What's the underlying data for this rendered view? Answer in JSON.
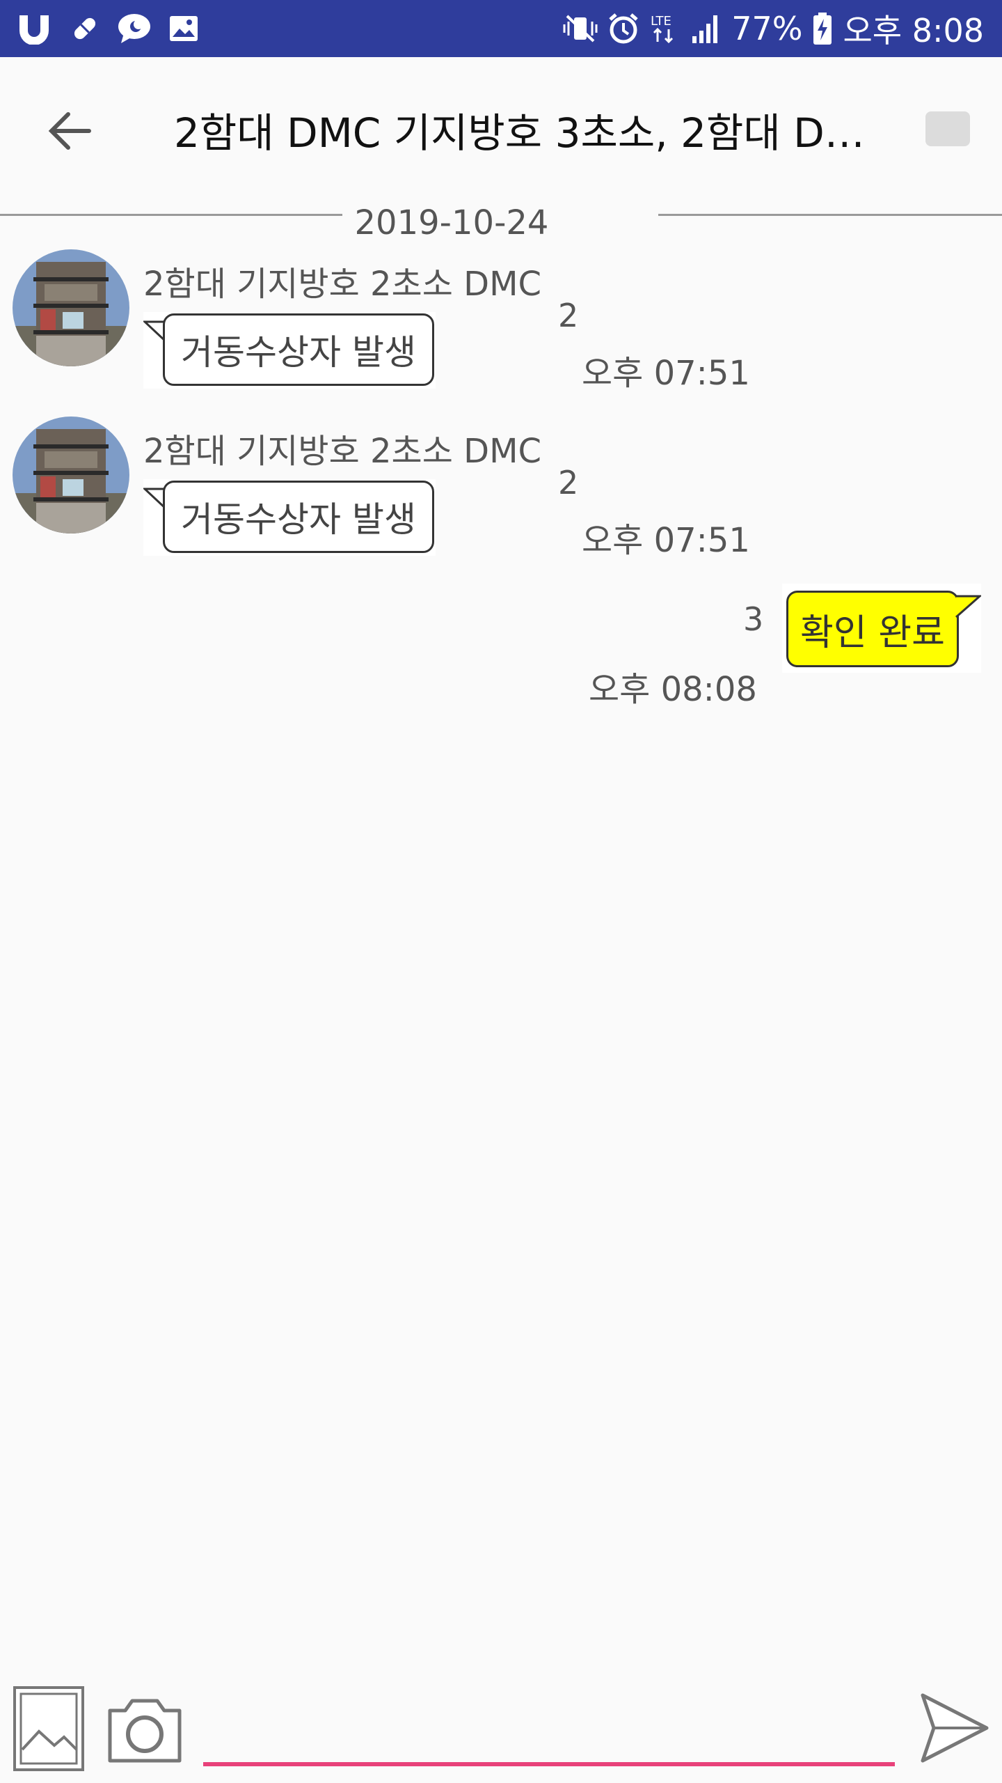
{
  "status_bar": {
    "left_icons": [
      "u-plus-icon",
      "pill-icon",
      "chat-bubble-icon",
      "image-icon"
    ],
    "right_icons": [
      "mute-vibrate-icon",
      "alarm-icon",
      "lte-icon",
      "signal-icon"
    ],
    "battery_percent": "77%",
    "battery_icon": "battery-charging-icon",
    "time": "오후 8:08"
  },
  "header": {
    "title": "2함대 DMC 기지방호 3초소, 2함대 DM…",
    "back_icon": "arrow-left-icon"
  },
  "chat": {
    "date_separator": "2019-10-24",
    "messages": [
      {
        "direction": "in",
        "sender": "2함대 기지방호 2초소 DMC",
        "text": "거동수상자 발생",
        "unread_count": "2",
        "time": "오후 07:51"
      },
      {
        "direction": "in",
        "sender": "2함대 기지방호 2초소 DMC",
        "text": "거동수상자 발생",
        "unread_count": "2",
        "time": "오후 07:51"
      },
      {
        "direction": "out",
        "text": "확인 완료",
        "unread_count": "3",
        "time": "오후 08:08"
      }
    ]
  },
  "input_bar": {
    "gallery_icon": "gallery-icon",
    "camera_icon": "camera-icon",
    "send_icon": "send-icon",
    "placeholder": "",
    "value": ""
  },
  "colors": {
    "status_bar": "#2f3d9c",
    "outgoing_bubble": "#ffff00",
    "input_underline": "#e8417a"
  }
}
